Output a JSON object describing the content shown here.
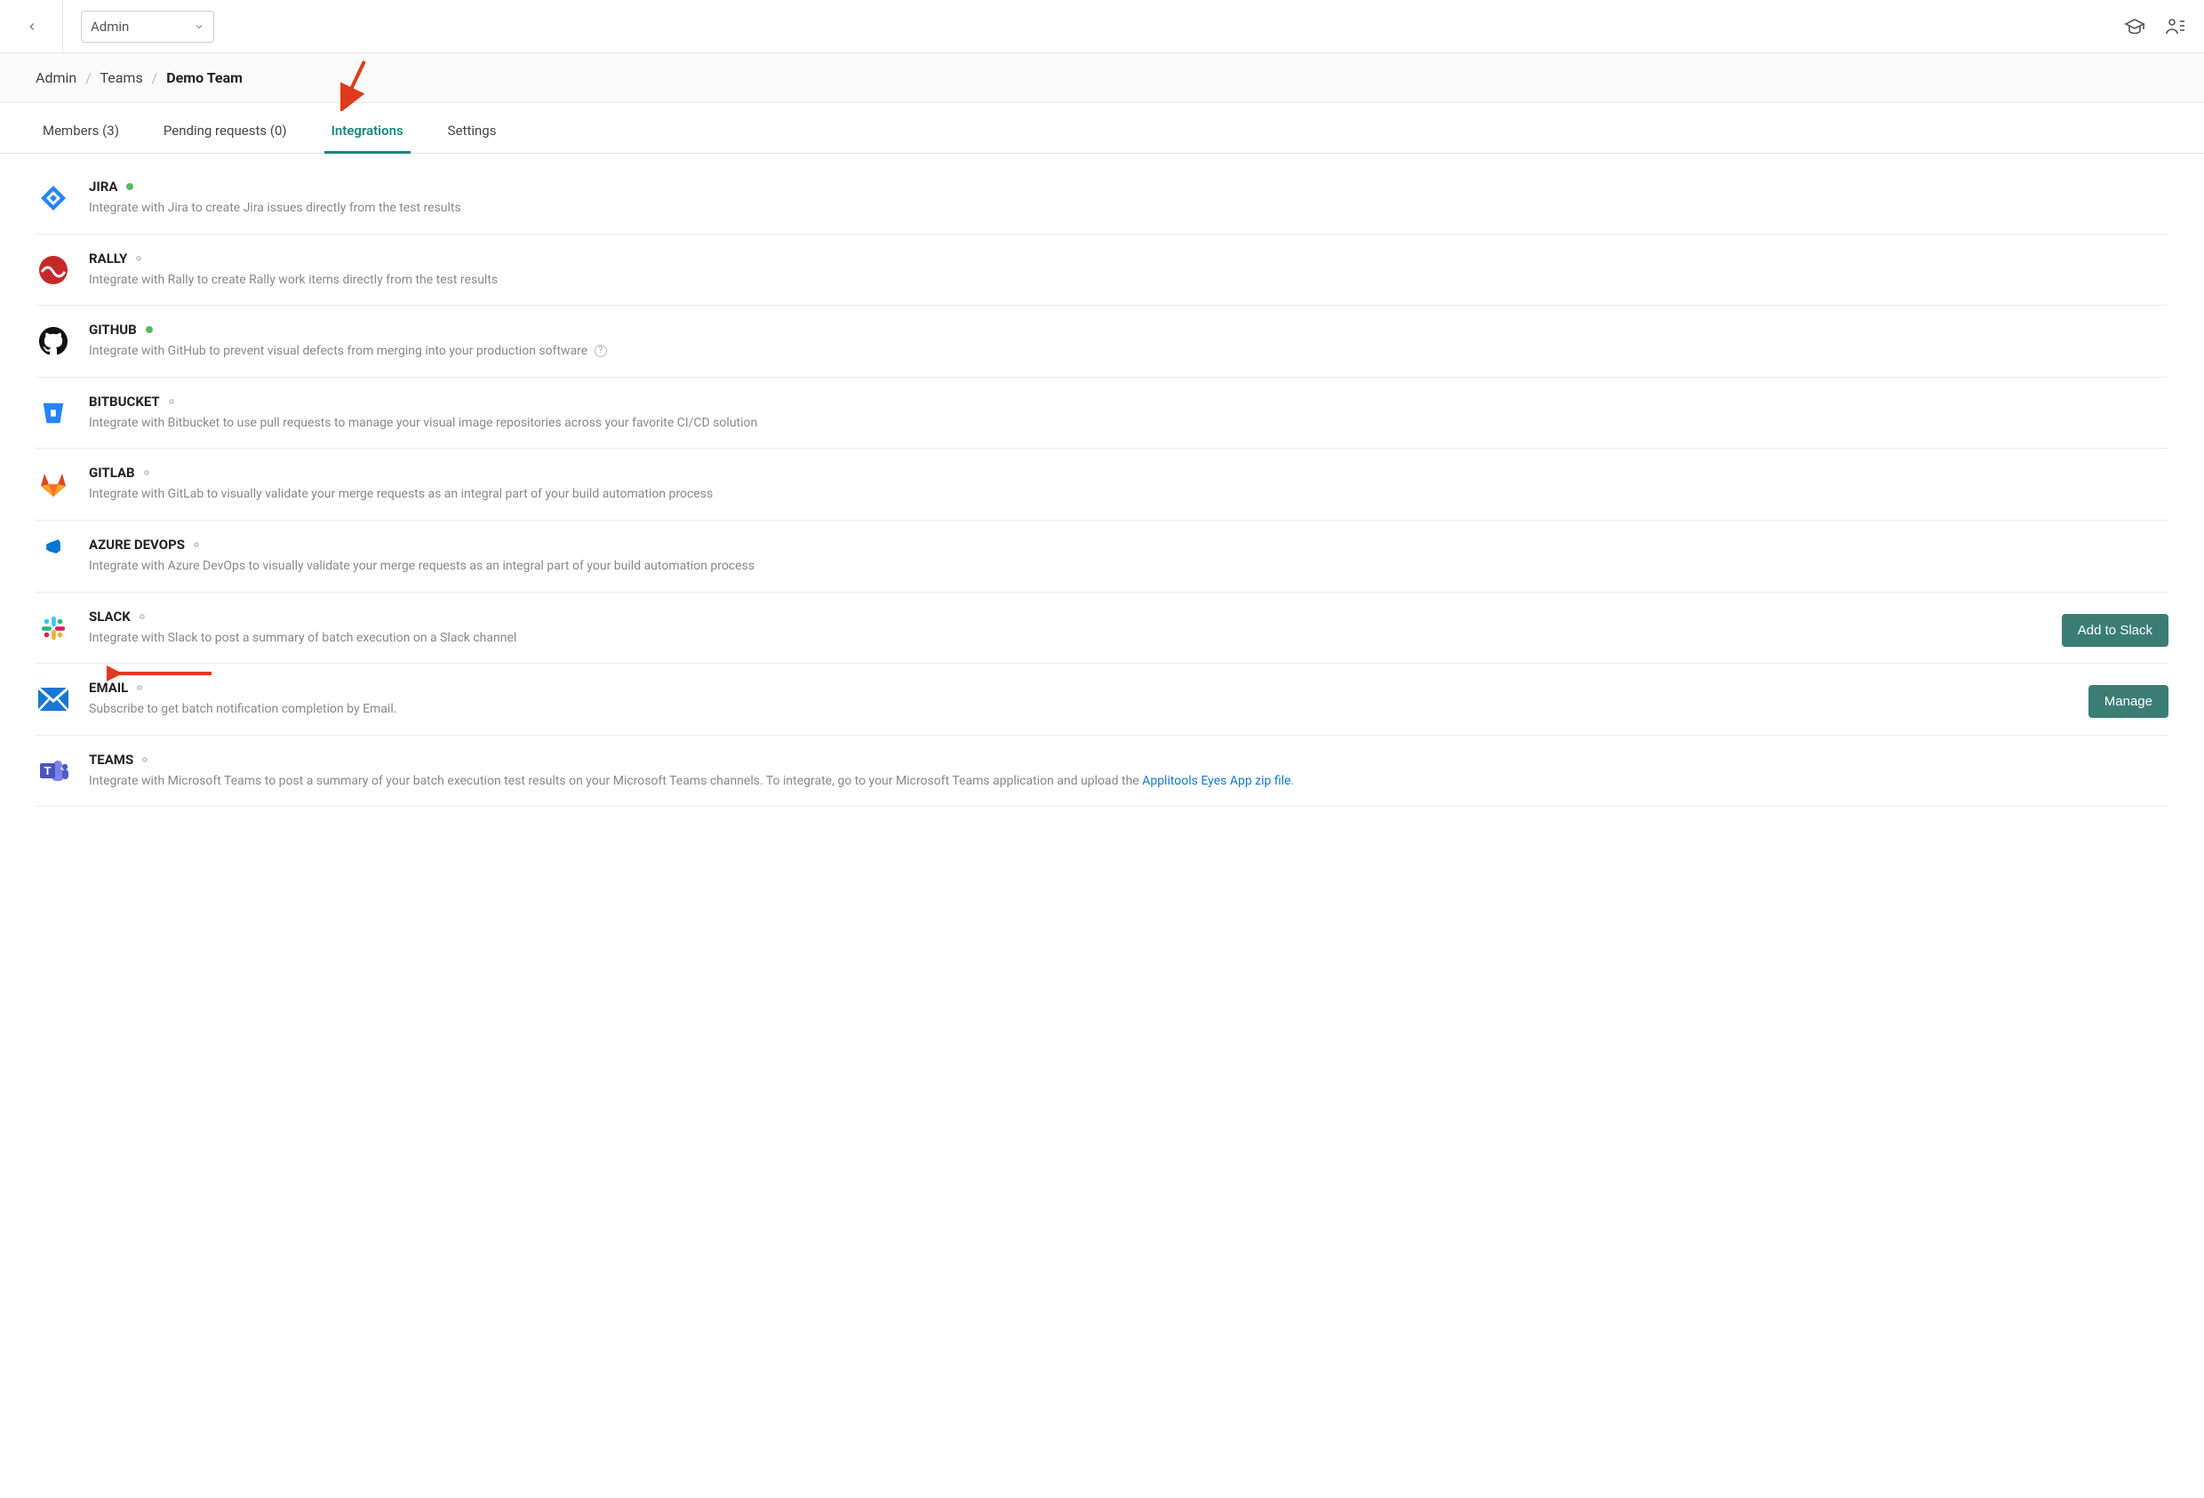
{
  "topbar": {
    "selector_value": "Admin"
  },
  "breadcrumb": {
    "items": [
      "Admin",
      "Teams",
      "Demo Team"
    ]
  },
  "tabs": {
    "members": "Members (3)",
    "pending": "Pending requests (0)",
    "integrations": "Integrations",
    "settings": "Settings"
  },
  "integrations": [
    {
      "id": "jira",
      "title": "JIRA",
      "status": "active",
      "desc": "Integrate with Jira to create Jira issues directly from the test results"
    },
    {
      "id": "rally",
      "title": "RALLY",
      "status": "inactive",
      "desc": "Integrate with Rally to create Rally work items directly from the test results"
    },
    {
      "id": "github",
      "title": "GITHUB",
      "status": "active",
      "help": true,
      "desc": "Integrate with GitHub to prevent visual defects from merging into your production software"
    },
    {
      "id": "bitbucket",
      "title": "BITBUCKET",
      "status": "inactive",
      "desc": "Integrate with Bitbucket to use pull requests to manage your visual image repositories across your favorite CI/CD solution"
    },
    {
      "id": "gitlab",
      "title": "GITLAB",
      "status": "inactive",
      "desc": "Integrate with GitLab to visually validate your merge requests as an integral part of your build automation process"
    },
    {
      "id": "azuredevops",
      "title": "AZURE DEVOPS",
      "status": "inactive",
      "desc": "Integrate with Azure DevOps to visually validate your merge requests as an integral part of your build automation process"
    },
    {
      "id": "slack",
      "title": "SLACK",
      "status": "inactive",
      "desc": "Integrate with Slack to post a summary of batch execution on a Slack channel",
      "action": "Add to Slack"
    },
    {
      "id": "email",
      "title": "EMAIL",
      "status": "inactive",
      "desc": "Subscribe to get batch notification completion by Email.",
      "action": "Manage"
    },
    {
      "id": "teams",
      "title": "TEAMS",
      "status": "inactive",
      "desc_prefix": "Integrate with Microsoft Teams to post a summary of your batch execution test results on your Microsoft Teams channels. To integrate, go to your Microsoft Teams application and upload the ",
      "desc_link": "Applitools Eyes App zip file",
      "desc_suffix": "."
    }
  ]
}
